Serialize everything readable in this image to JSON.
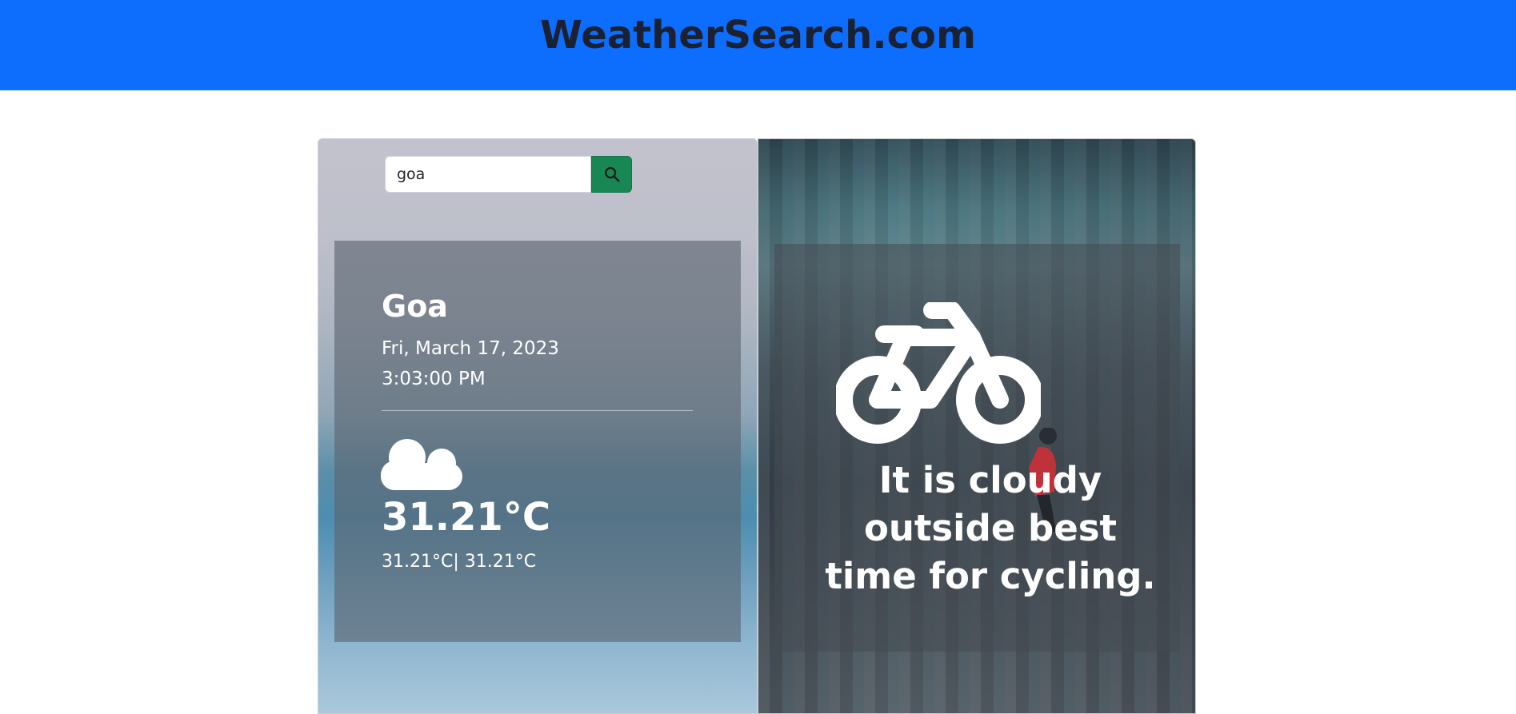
{
  "navbar": {
    "brand": "WeatherSearch.com"
  },
  "search": {
    "value": "goa",
    "button_icon": "search-icon"
  },
  "weather": {
    "city": "Goa",
    "date": "Fri, March 17, 2023",
    "time": "3:03:00 PM",
    "condition_icon": "cloud-icon",
    "temperature": "31.21°C",
    "min_max": "31.21°C| 31.21°C"
  },
  "suggestion": {
    "activity_icon": "bicycle-icon",
    "message": "It is cloudy outside best time for cycling."
  },
  "colors": {
    "navbar": "#0d6efd",
    "search_button": "#198754",
    "text_light": "#ffffff",
    "brand_text": "#1b2130"
  }
}
